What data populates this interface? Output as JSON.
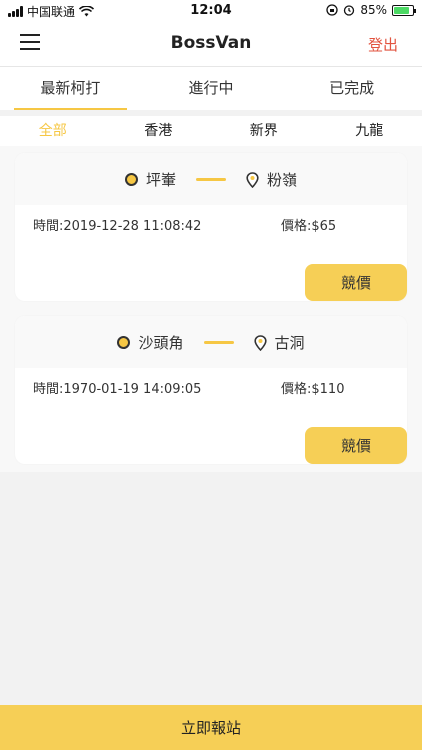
{
  "status_bar": {
    "carrier": "中国联通",
    "time": "12:04",
    "battery": "85%",
    "battery_level": 0.85
  },
  "header": {
    "title": "BossVan",
    "logout_label": "登出"
  },
  "tabs": [
    {
      "label": "最新柯打",
      "active": true
    },
    {
      "label": "進行中",
      "active": false
    },
    {
      "label": "已完成",
      "active": false
    }
  ],
  "regions": [
    {
      "label": "全部",
      "active": true
    },
    {
      "label": "香港",
      "active": false
    },
    {
      "label": "新界",
      "active": false
    },
    {
      "label": "九龍",
      "active": false
    }
  ],
  "orders": [
    {
      "from": "坪輋",
      "to": "粉嶺",
      "time": "時間:2019-12-28 11:08:42",
      "price": "價格:$65",
      "bid_label": "競價"
    },
    {
      "from": "沙頭角",
      "to": "古洞",
      "time": "時間:1970-01-19 14:09:05",
      "price": "價格:$110",
      "bid_label": "競價"
    }
  ],
  "footer": {
    "report_label": "立即報站"
  },
  "colors": {
    "accent": "#f6cf56",
    "logout": "#e2533f",
    "background": "#f2f2f2"
  }
}
